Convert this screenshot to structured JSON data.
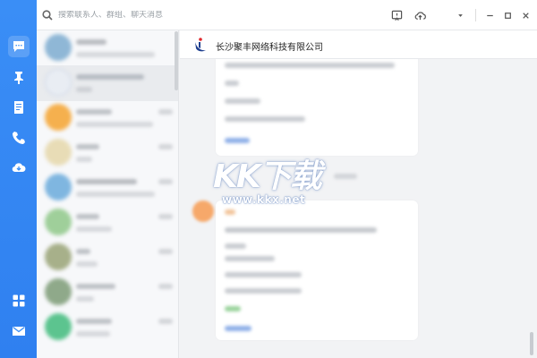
{
  "search": {
    "placeholder": "搜索联系人、群组、聊天消息"
  },
  "rail": {
    "items": [
      {
        "name": "message-icon",
        "active": true
      },
      {
        "name": "pin-icon"
      },
      {
        "name": "notebook-icon"
      },
      {
        "name": "phone-icon"
      },
      {
        "name": "cloud-icon"
      },
      {
        "name": "apps-grid-icon"
      },
      {
        "name": "mail-icon"
      }
    ]
  },
  "chat": {
    "company_name": "长沙聚丰网络科技有限公司"
  },
  "watermark": {
    "text": "KK下载",
    "url": "www.kkx.net"
  },
  "colors": {
    "rail": "#3a8ef6",
    "accent": "#2f80f0"
  }
}
